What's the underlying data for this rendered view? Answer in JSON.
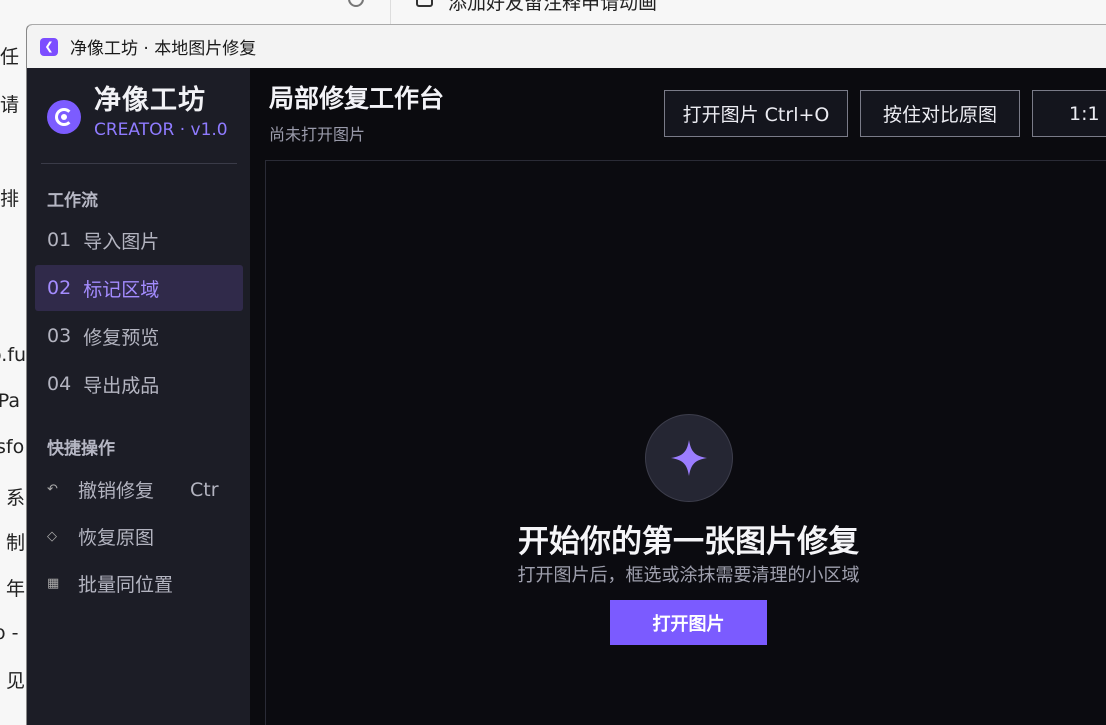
{
  "background": {
    "left_fragments": [
      "任",
      "请",
      "排",
      "o.fu",
      "rPa",
      "sfo",
      "系",
      "制",
      "年",
      "o -",
      "见"
    ],
    "top_text": "添加好友留注释申请动画"
  },
  "window": {
    "title": "净像工坊 · 本地图片修复"
  },
  "brand": {
    "name": "净像工坊",
    "subtitle": "CREATOR · v1.0"
  },
  "sidebar": {
    "workflow_heading": "工作流",
    "workflow": [
      {
        "num": "01",
        "label": "导入图片"
      },
      {
        "num": "02",
        "label": "标记区域"
      },
      {
        "num": "03",
        "label": "修复预览"
      },
      {
        "num": "04",
        "label": "导出成品"
      }
    ],
    "quick_heading": "快捷操作",
    "quick": [
      {
        "icon": "↶",
        "label": "撤销修复",
        "shortcut": "Ctr"
      },
      {
        "icon": "◇",
        "label": "恢复原图"
      },
      {
        "icon": "▦",
        "label": "批量同位置"
      }
    ]
  },
  "header": {
    "title": "局部修复工作台",
    "subtitle": "尚未打开图片"
  },
  "toolbar": {
    "open_label": "打开图片  Ctrl+O",
    "compare_label": "按住对比原图",
    "zoom_label": "1:1"
  },
  "empty_state": {
    "icon": "sparkle-icon",
    "title": "开始你的第一张图片修复",
    "description": "打开图片后，框选或涂抹需要清理的小区域",
    "button": "打开图片"
  },
  "colors": {
    "accent": "#7b5bff",
    "sidebar_bg": "#1c1d26",
    "canvas_bg": "#0b0b10"
  }
}
